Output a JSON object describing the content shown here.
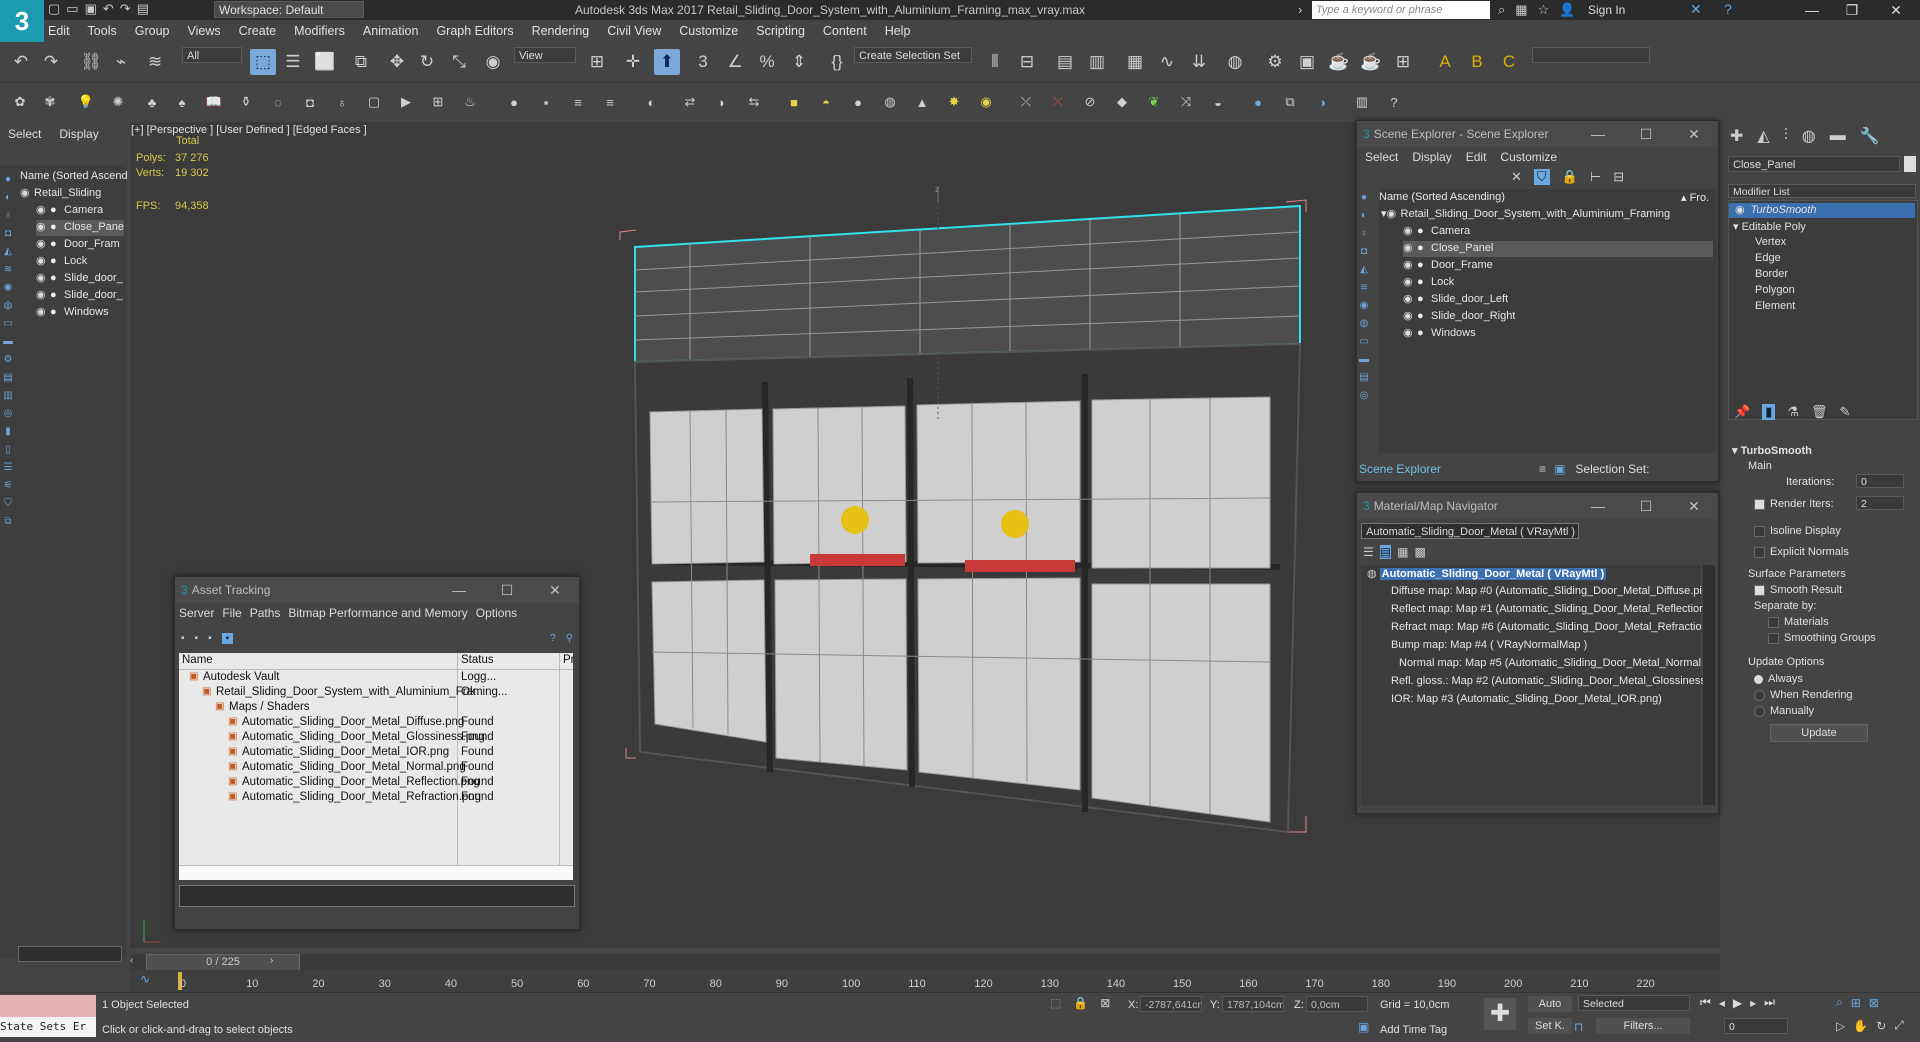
{
  "titlebar": {
    "workspace": "Workspace: Default",
    "app_title": "Autodesk 3ds Max 2017      Retail_Sliding_Door_System_with_Aluminium_Framing_max_vray.max",
    "search_placeholder": "Type a keyword or phrase",
    "sign_in": "Sign In"
  },
  "menubar": [
    "Edit",
    "Tools",
    "Group",
    "Views",
    "Create",
    "Modifiers",
    "Animation",
    "Graph Editors",
    "Rendering",
    "Civil View",
    "Customize",
    "Scripting",
    "Content",
    "Help"
  ],
  "toolbar": {
    "filter": "All",
    "view": "View",
    "selection_set": "Create Selection Set"
  },
  "left_panel": {
    "tabs": [
      "Select",
      "Display"
    ],
    "header": "Name (Sorted Ascend",
    "root": "Retail_Sliding",
    "items": [
      "Camera",
      "Close_Pane",
      "Door_Fram",
      "Lock",
      "Slide_door_",
      "Slide_door_",
      "Windows"
    ]
  },
  "viewport": {
    "label": "[+] [Perspective ] [User Defined ] [Edged Faces ]",
    "total": "Total",
    "polys_label": "Polys:",
    "polys": "37 276",
    "verts_label": "Verts:",
    "verts": "19 302",
    "fps_label": "FPS:",
    "fps": "94,358",
    "axis_z": "z"
  },
  "scene_explorer": {
    "title": "Scene Explorer - Scene Explorer",
    "menu": [
      "Select",
      "Display",
      "Edit",
      "Customize"
    ],
    "header": "Name (Sorted Ascending)",
    "header_right": "▴ Fro...",
    "root": "Retail_Sliding_Door_System_with_Aluminium_Framing",
    "items": [
      "Camera",
      "Close_Panel",
      "Door_Frame",
      "Lock",
      "Slide_door_Left",
      "Slide_door_Right",
      "Windows"
    ],
    "footer_left": "Scene Explorer",
    "footer_right": "Selection Set:"
  },
  "material_nav": {
    "title": "Material/Map Navigator",
    "current": "Automatic_Sliding_Door_Metal  ( VRayMtl )",
    "root": "Automatic_Sliding_Door_Metal  ( VRayMtl )",
    "maps": [
      "Diffuse map: Map #0 (Automatic_Sliding_Door_Metal_Diffuse.pi",
      "Reflect map: Map #1 (Automatic_Sliding_Door_Metal_Reflectior",
      "Refract map: Map #6 (Automatic_Sliding_Door_Metal_Refractio",
      "Bump map: Map #4  ( VRayNormalMap )",
      "Normal map: Map #5 (Automatic_Sliding_Door_Metal_Normal",
      "Refl. gloss.: Map #2 (Automatic_Sliding_Door_Metal_Glossiness.",
      "IOR: Map #3 (Automatic_Sliding_Door_Metal_IOR.png)"
    ]
  },
  "asset_tracking": {
    "title": "Asset Tracking",
    "menu": [
      "Server",
      "File",
      "Paths",
      "Bitmap Performance and Memory",
      "Options"
    ],
    "columns": [
      "Name",
      "Status",
      "Pr"
    ],
    "rows": [
      {
        "name": "Autodesk Vault",
        "status": "Logg...",
        "indent": 0
      },
      {
        "name": "Retail_Sliding_Door_System_with_Aluminium_Framing...",
        "status": "Ok",
        "indent": 1
      },
      {
        "name": "Maps / Shaders",
        "status": "",
        "indent": 2
      },
      {
        "name": "Automatic_Sliding_Door_Metal_Diffuse.png",
        "status": "Found",
        "indent": 3
      },
      {
        "name": "Automatic_Sliding_Door_Metal_Glossiness.png",
        "status": "Found",
        "indent": 3
      },
      {
        "name": "Automatic_Sliding_Door_Metal_IOR.png",
        "status": "Found",
        "indent": 3
      },
      {
        "name": "Automatic_Sliding_Door_Metal_Normal.png",
        "status": "Found",
        "indent": 3
      },
      {
        "name": "Automatic_Sliding_Door_Metal_Reflection.png",
        "status": "Found",
        "indent": 3
      },
      {
        "name": "Automatic_Sliding_Door_Metal_Refraction.png",
        "status": "Found",
        "indent": 3
      }
    ]
  },
  "command_panel": {
    "object_name": "Close_Panel",
    "modifier_list": "Modifier List",
    "stack": [
      "TurboSmooth",
      "Editable Poly",
      "Vertex",
      "Edge",
      "Border",
      "Polygon",
      "Element"
    ],
    "rollout_title": "TurboSmooth",
    "main": "Main",
    "iterations_label": "Iterations:",
    "iterations": "0",
    "render_iters_label": "Render Iters:",
    "render_iters": "2",
    "isoline": "Isoline Display",
    "explicit": "Explicit Normals",
    "surface_params": "Surface Parameters",
    "smooth_result": "Smooth Result",
    "separate_by": "Separate by:",
    "materials": "Materials",
    "smoothing_groups": "Smoothing Groups",
    "update_options": "Update Options",
    "always": "Always",
    "when_rendering": "When Rendering",
    "manually": "Manually",
    "update": "Update"
  },
  "timeline": {
    "frame": "0 / 225",
    "ticks": [
      "0",
      "10",
      "20",
      "30",
      "40",
      "50",
      "60",
      "70",
      "80",
      "90",
      "100",
      "110",
      "120",
      "130",
      "140",
      "150",
      "160",
      "170",
      "180",
      "190",
      "200",
      "210",
      "220"
    ]
  },
  "statusbar": {
    "state_sets": "State Sets Er",
    "selected": "1 Object Selected",
    "prompt": "Click or click-and-drag to select objects",
    "x_label": "X:",
    "x": "-2787,641cm",
    "y_label": "Y:",
    "y": "1787,104cm",
    "z_label": "Z:",
    "z": "0,0cm",
    "grid": "Grid = 10,0cm",
    "add_time_tag": "Add Time Tag",
    "auto": "Auto",
    "set_k": "Set K.",
    "selected_dd": "Selected",
    "filters": "Filters...",
    "frame_field": "0"
  }
}
